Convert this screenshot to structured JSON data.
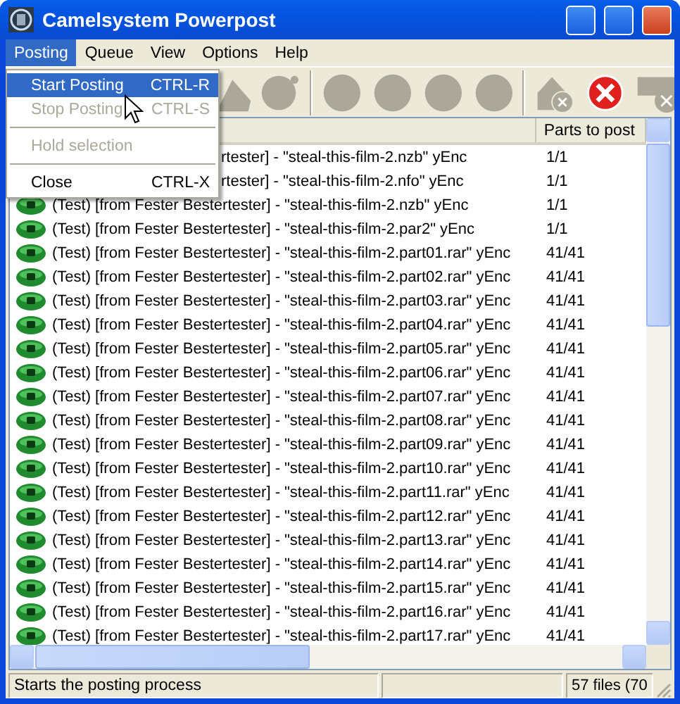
{
  "window": {
    "title": "Camelsystem Powerpost"
  },
  "menubar": [
    {
      "label": "Posting",
      "selected": true
    },
    {
      "label": "Queue",
      "selected": false
    },
    {
      "label": "View",
      "selected": false
    },
    {
      "label": "Options",
      "selected": false
    },
    {
      "label": "Help",
      "selected": false
    }
  ],
  "menu": {
    "items": [
      {
        "kind": "item",
        "label": "Start Posting",
        "shortcut": "CTRL-R",
        "selected": true,
        "disabled": false
      },
      {
        "kind": "item",
        "label": "Stop Posting",
        "shortcut": "CTRL-S",
        "selected": false,
        "disabled": true
      },
      {
        "kind": "separator"
      },
      {
        "kind": "item",
        "label": "Hold selection",
        "selected": false,
        "disabled": true
      },
      {
        "kind": "separator"
      },
      {
        "kind": "item",
        "label": "Close",
        "shortcut": "CTRL-X",
        "selected": false,
        "disabled": false
      }
    ]
  },
  "table": {
    "columns": [
      {
        "label": "Parts to post"
      }
    ],
    "rows": [
      {
        "kind": "partial",
        "name": "rtester] - \"steal-this-film-2.nzb\" yEnc",
        "parts": "1/1"
      },
      {
        "kind": "partial",
        "name": "rtester] - \"steal-this-film-2.nfo\" yEnc",
        "parts": "1/1"
      },
      {
        "kind": "full",
        "name": "(Test) [from Fester Bestertester] - \"steal-this-film-2.nzb\" yEnc",
        "parts": "1/1"
      },
      {
        "kind": "full",
        "name": "(Test) [from Fester Bestertester] - \"steal-this-film-2.par2\" yEnc",
        "parts": "1/1"
      },
      {
        "kind": "full",
        "name": "(Test) [from Fester Bestertester] - \"steal-this-film-2.part01.rar\" yEnc",
        "parts": "41/41"
      },
      {
        "kind": "full",
        "name": "(Test) [from Fester Bestertester] - \"steal-this-film-2.part02.rar\" yEnc",
        "parts": "41/41"
      },
      {
        "kind": "full",
        "name": "(Test) [from Fester Bestertester] - \"steal-this-film-2.part03.rar\" yEnc",
        "parts": "41/41"
      },
      {
        "kind": "full",
        "name": "(Test) [from Fester Bestertester] - \"steal-this-film-2.part04.rar\" yEnc",
        "parts": "41/41"
      },
      {
        "kind": "full",
        "name": "(Test) [from Fester Bestertester] - \"steal-this-film-2.part05.rar\" yEnc",
        "parts": "41/41"
      },
      {
        "kind": "full",
        "name": "(Test) [from Fester Bestertester] - \"steal-this-film-2.part06.rar\" yEnc",
        "parts": "41/41"
      },
      {
        "kind": "full",
        "name": "(Test) [from Fester Bestertester] - \"steal-this-film-2.part07.rar\" yEnc",
        "parts": "41/41"
      },
      {
        "kind": "full",
        "name": "(Test) [from Fester Bestertester] - \"steal-this-film-2.part08.rar\" yEnc",
        "parts": "41/41"
      },
      {
        "kind": "full",
        "name": "(Test) [from Fester Bestertester] - \"steal-this-film-2.part09.rar\" yEnc",
        "parts": "41/41"
      },
      {
        "kind": "full",
        "name": "(Test) [from Fester Bestertester] - \"steal-this-film-2.part10.rar\" yEnc",
        "parts": "41/41"
      },
      {
        "kind": "full",
        "name": "(Test) [from Fester Bestertester] - \"steal-this-film-2.part11.rar\" yEnc",
        "parts": "41/41"
      },
      {
        "kind": "full",
        "name": "(Test) [from Fester Bestertester] - \"steal-this-film-2.part12.rar\" yEnc",
        "parts": "41/41"
      },
      {
        "kind": "full",
        "name": "(Test) [from Fester Bestertester] - \"steal-this-film-2.part13.rar\" yEnc",
        "parts": "41/41"
      },
      {
        "kind": "full",
        "name": "(Test) [from Fester Bestertester] - \"steal-this-film-2.part14.rar\" yEnc",
        "parts": "41/41"
      },
      {
        "kind": "full",
        "name": "(Test) [from Fester Bestertester] - \"steal-this-film-2.part15.rar\" yEnc",
        "parts": "41/41"
      },
      {
        "kind": "full",
        "name": "(Test) [from Fester Bestertester] - \"steal-this-film-2.part16.rar\" yEnc",
        "parts": "41/41"
      },
      {
        "kind": "full",
        "name": "(Test) [from Fester Bestertester] - \"steal-this-film-2.part17.rar\" yEnc",
        "parts": "41/41"
      }
    ]
  },
  "status_bar": {
    "message": "Starts the posting process",
    "count": "57 files (70"
  }
}
